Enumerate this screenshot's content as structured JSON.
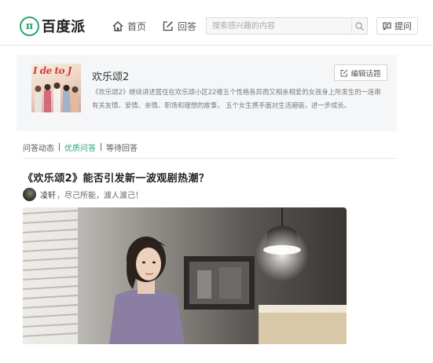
{
  "header": {
    "logo_mark": "π",
    "logo_text": "百度派",
    "nav": [
      {
        "label": "首页",
        "icon": "home-icon"
      },
      {
        "label": "回答",
        "icon": "edit-icon"
      }
    ],
    "search_placeholder": "搜索感兴趣的内容",
    "search_icon": "search-icon",
    "ask_label": "提问",
    "ask_icon": "chat-icon"
  },
  "topic": {
    "thumb_title": "I de to J",
    "name": "欢乐颂2",
    "edit_label": "编辑话题",
    "description": "《欢乐颂2》继续讲述居住在欢乐颂小区22楼五个性格各异而又相亲相爱的女孩身上所发生的一连串有关友情、爱情、亲情、职场和理想的故事， 五个女生携手面对生活磨砺，进一步成长。"
  },
  "tabs": [
    {
      "label": "问答动态",
      "active": false
    },
    {
      "label": "优质问答",
      "active": true
    },
    {
      "label": "等待回答",
      "active": false
    }
  ],
  "question": {
    "title": "《欢乐颂2》能否引发新一波观剧热潮？",
    "author_name": "凌轩",
    "author_bio": "，尽己所能，渡人渡己！"
  },
  "colors": {
    "brand": "#2ba471",
    "card_bg": "#f4f6f8",
    "text": "#333333",
    "muted": "#7a7a7a"
  }
}
